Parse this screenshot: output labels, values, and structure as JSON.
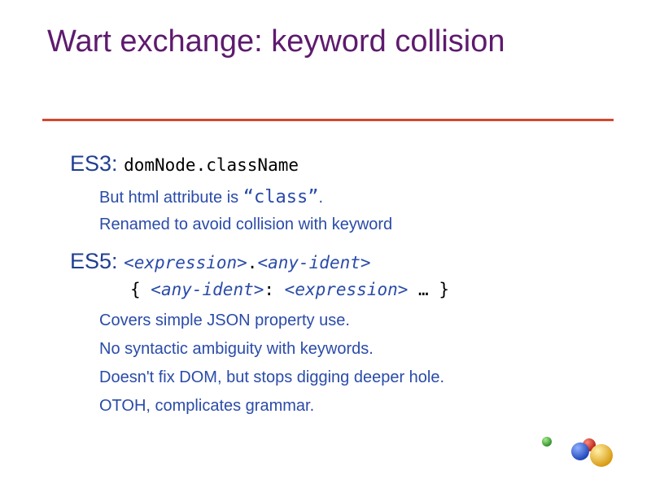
{
  "slide": {
    "title": "Wart exchange: keyword collision"
  },
  "es3": {
    "label": "ES3:",
    "code": "domNode.className",
    "bullet1_pre": "But html attribute is ",
    "bullet1_code": "“class”",
    "bullet1_post": ".",
    "bullet2": "Renamed to avoid collision with keyword"
  },
  "es5": {
    "label": "ES5:",
    "line1_a": "<expression>",
    "line1_dot": ".",
    "line1_b": "<any-ident>",
    "line2_open": "{ ",
    "line2_a": "<any-ident>",
    "line2_colon": ": ",
    "line2_b": "<expression>",
    "line2_close": " … }",
    "bullets": [
      "Covers simple JSON property use.",
      "No syntactic ambiguity with keywords.",
      "Doesn't fix DOM, but stops digging deeper hole.",
      "OTOH, complicates grammar."
    ]
  },
  "colors": {
    "title": "#5e1a6e",
    "accent_rule": "#d8452e",
    "text_blue": "#2a4ba8",
    "logo_green": "#3aa635",
    "logo_blue": "#2b5fd1",
    "logo_red": "#d6261e",
    "logo_yellow": "#f2b52a"
  },
  "icons": {
    "logo": "google-balls-logo"
  }
}
